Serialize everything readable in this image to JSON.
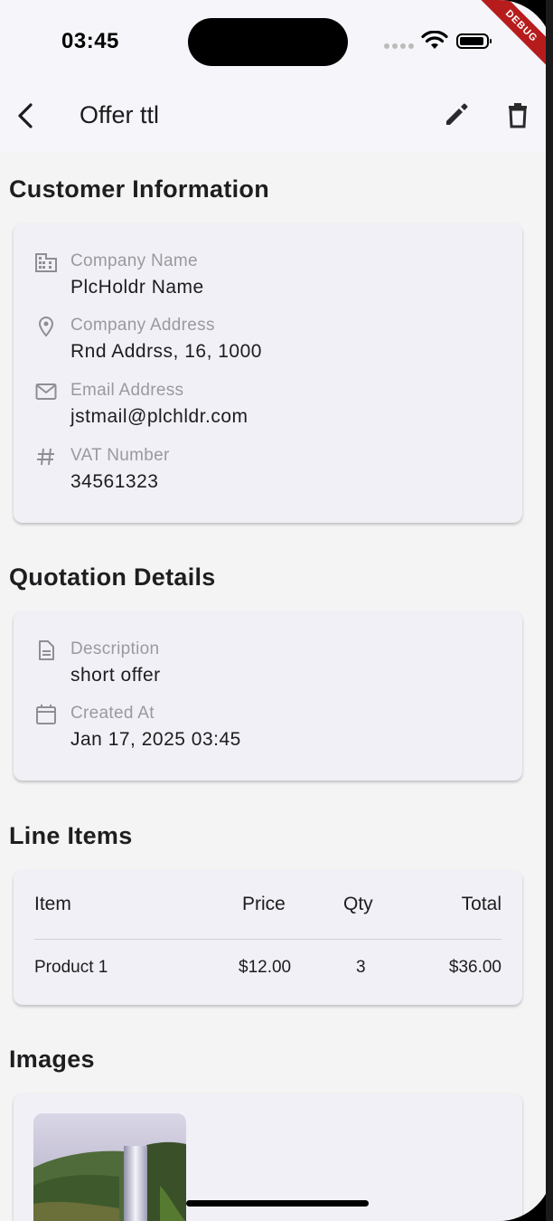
{
  "status_bar": {
    "time": "03:45",
    "debug_label": "DEBUG"
  },
  "app_bar": {
    "title": "Offer ttl",
    "back_icon": "chevron-left-icon",
    "edit_icon": "pencil-icon",
    "delete_icon": "trash-icon"
  },
  "customer": {
    "section_title": "Customer Information",
    "fields": [
      {
        "label": "Company Name",
        "value": "PlcHoldr Name",
        "icon": "building-icon"
      },
      {
        "label": "Company Address",
        "value": "Rnd Addrss, 16, 1000",
        "icon": "location-pin-icon"
      },
      {
        "label": "Email Address",
        "value": "jstmail@plchldr.com",
        "icon": "envelope-icon"
      },
      {
        "label": "VAT Number",
        "value": "34561323",
        "icon": "hash-icon"
      }
    ]
  },
  "quotation": {
    "section_title": "Quotation Details",
    "fields": [
      {
        "label": "Description",
        "value": "short offer",
        "icon": "document-icon"
      },
      {
        "label": "Created At",
        "value": "Jan 17, 2025 03:45",
        "icon": "calendar-icon"
      }
    ]
  },
  "line_items": {
    "section_title": "Line Items",
    "headers": [
      "Item",
      "Price",
      "Qty",
      "Total"
    ],
    "rows": [
      [
        "Product 1",
        "$12.00",
        "3",
        "$36.00"
      ]
    ]
  },
  "images": {
    "section_title": "Images"
  }
}
